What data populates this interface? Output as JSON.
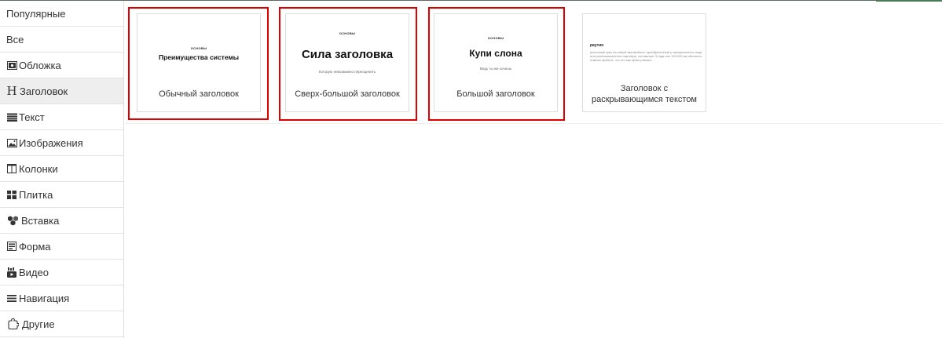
{
  "sidebar": {
    "items": [
      {
        "label": "Популярные",
        "icon": ""
      },
      {
        "label": "Все",
        "icon": ""
      },
      {
        "label": "Обложка",
        "icon": "cover-icon"
      },
      {
        "label": "Заголовок",
        "icon": "heading-icon",
        "active": true
      },
      {
        "label": "Текст",
        "icon": "text-icon"
      },
      {
        "label": "Изображения",
        "icon": "image-icon"
      },
      {
        "label": "Колонки",
        "icon": "columns-icon"
      },
      {
        "label": "Плитка",
        "icon": "tiles-icon"
      },
      {
        "label": "Вставка",
        "icon": "embed-icon"
      },
      {
        "label": "Форма",
        "icon": "form-icon"
      },
      {
        "label": "Видео",
        "icon": "youtube-icon"
      },
      {
        "label": "Навигация",
        "icon": "menu-icon"
      },
      {
        "label": "Другие",
        "icon": "puzzle-icon"
      }
    ],
    "heading_glyph": "H"
  },
  "cards": [
    {
      "label": "Обычный заголовок",
      "preview": {
        "kicker": "ОСНОВЫ",
        "title": "Преимущества системы"
      },
      "highlighted": true
    },
    {
      "label": "Сверх-большой заголовок",
      "preview": {
        "kicker": "ОСНОВЫ",
        "title": "Сила заголовка",
        "subtitle": "Которую невозможно переоценить"
      },
      "highlighted": true
    },
    {
      "label": "Большой заголовок",
      "preview": {
        "kicker": "ОСНОВЫ",
        "title": "Купи слона",
        "subtitle": "Ведь ты же хочешь"
      },
      "highlighted": true
    },
    {
      "label": "Заголовок с раскрывающимся текстом",
      "preview": {
        "title": "раутин",
        "paragraph": "рыночный трик на новый автомобиль, приобретенный у официального лица или уполномоченного партнёра, составляет 3 года или 100 000 км обычного лимита пробега, что это как купил раньше"
      },
      "highlighted": false
    }
  ],
  "colors": {
    "highlight": "#e00000",
    "active_bg": "#eeeeee",
    "border": "#dddddd"
  }
}
